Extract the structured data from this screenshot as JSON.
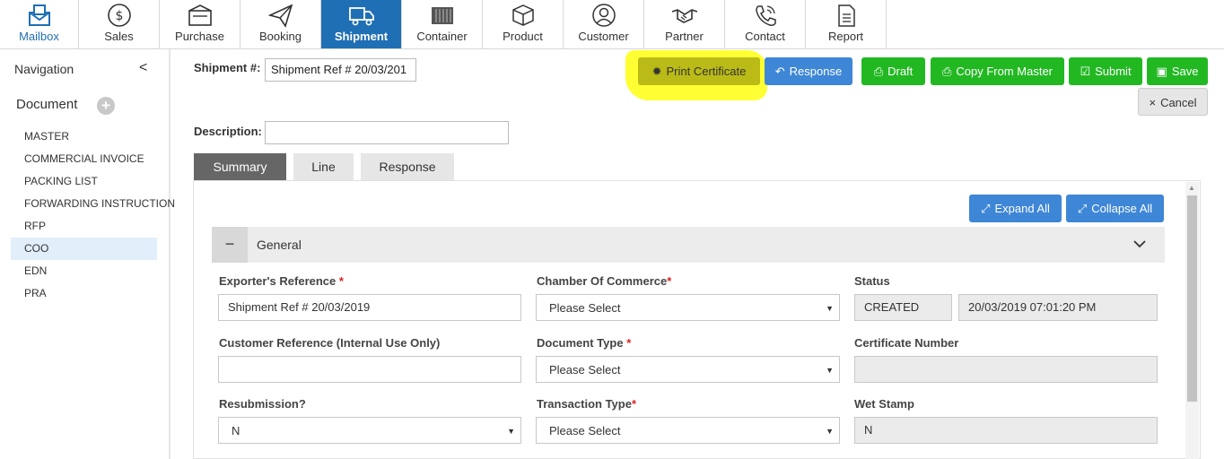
{
  "topnav": {
    "items": [
      {
        "label": "Mailbox",
        "icon": "mailbox-icon"
      },
      {
        "label": "Sales",
        "icon": "dollar-icon"
      },
      {
        "label": "Purchase",
        "icon": "purchase-icon"
      },
      {
        "label": "Booking",
        "icon": "paper-plane-icon"
      },
      {
        "label": "Shipment",
        "icon": "truck-icon"
      },
      {
        "label": "Container",
        "icon": "container-icon"
      },
      {
        "label": "Product",
        "icon": "box-icon"
      },
      {
        "label": "Customer",
        "icon": "person-icon"
      },
      {
        "label": "Partner",
        "icon": "handshake-icon"
      },
      {
        "label": "Contact",
        "icon": "phone-icon"
      },
      {
        "label": "Report",
        "icon": "report-icon"
      }
    ],
    "active": "Shipment"
  },
  "sidebar": {
    "title": "Navigation",
    "collapse": "<",
    "section": "Document",
    "add": "+",
    "items": [
      {
        "label": "MASTER"
      },
      {
        "label": "COMMERCIAL INVOICE"
      },
      {
        "label": "PACKING LIST"
      },
      {
        "label": "FORWARDING INSTRUCTION"
      },
      {
        "label": "RFP"
      },
      {
        "label": "COO"
      },
      {
        "label": "EDN"
      },
      {
        "label": "PRA"
      }
    ],
    "selected": "COO"
  },
  "header": {
    "shipment_label": "Shipment #:",
    "shipment_value": "Shipment Ref # 20/03/201",
    "description_label": "Description:",
    "description_value": ""
  },
  "toolbar": {
    "print_certificate": "Print Certificate",
    "response": "Response",
    "draft": "Draft",
    "copy_from_master": "Copy From Master",
    "submit": "Submit",
    "save": "Save",
    "cancel": "Cancel"
  },
  "tabs": [
    {
      "label": "Summary"
    },
    {
      "label": "Line"
    },
    {
      "label": "Response"
    }
  ],
  "panel": {
    "expand_all": "Expand All",
    "collapse_all": "Collapse All",
    "general_toggle": "−",
    "general_title": "General"
  },
  "form": {
    "exporters_reference": {
      "label": "Exporter's Reference",
      "req": "*",
      "value": "Shipment Ref # 20/03/2019"
    },
    "chamber_of_commerce": {
      "label": "Chamber Of Commerce",
      "req": "*",
      "value": "Please Select"
    },
    "status": {
      "label": "Status",
      "value": "CREATED",
      "timestamp": "20/03/2019 07:01:20 PM"
    },
    "customer_reference": {
      "label": "Customer Reference ",
      "label_bold": "(Internal Use Only)",
      "value": ""
    },
    "document_type": {
      "label": "Document Type",
      "req": "*",
      "value": "Please Select"
    },
    "certificate_number": {
      "label": "Certificate Number",
      "value": ""
    },
    "resubmission": {
      "label": "Resubmission?",
      "value": "N"
    },
    "transaction_type": {
      "label": "Transaction Type",
      "req": "*",
      "value": "Please Select"
    },
    "wet_stamp": {
      "label": "Wet Stamp",
      "value": "N"
    }
  },
  "colors": {
    "primary": "#1f6fb5",
    "success": "#22b822",
    "info": "#3e86d6",
    "highlight": "#ffff33"
  }
}
